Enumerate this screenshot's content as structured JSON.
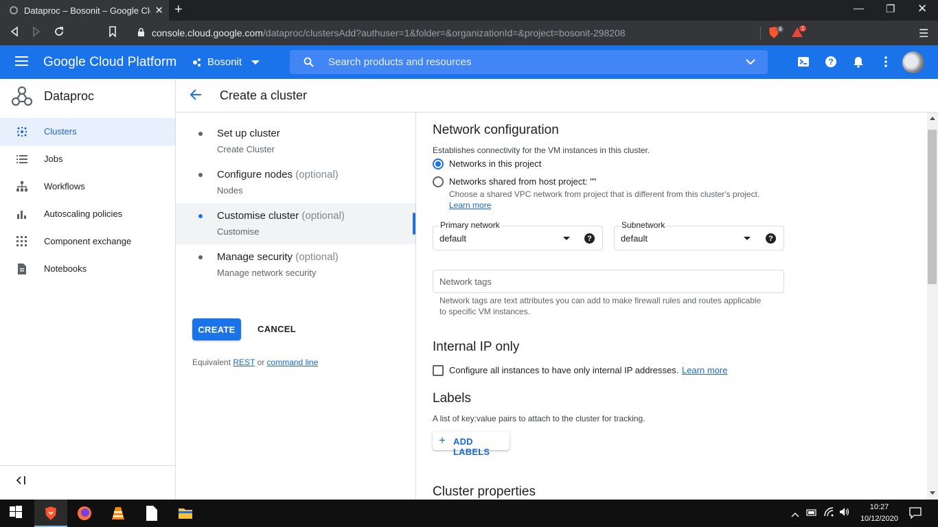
{
  "browser": {
    "tab_title": "Dataproc – Bosonit – Google Cloud",
    "url_host": "console.cloud.google.com",
    "url_path": "/dataproc/clustersAdd?authuser=1&folder=&organizationId=&project=bosonit-298208",
    "brave_badge": "4",
    "alert_badge": "1"
  },
  "header": {
    "brand": "Google Cloud Platform",
    "project": "Bosonit",
    "search_placeholder": "Search products and resources"
  },
  "sidebar": {
    "product": "Dataproc",
    "items": [
      {
        "label": "Clusters",
        "icon": "clusters-icon",
        "active": true
      },
      {
        "label": "Jobs",
        "icon": "list-icon",
        "active": false
      },
      {
        "label": "Workflows",
        "icon": "workflow-icon",
        "active": false
      },
      {
        "label": "Autoscaling policies",
        "icon": "bar-chart-icon",
        "active": false
      },
      {
        "label": "Component exchange",
        "icon": "grid-icon",
        "active": false
      },
      {
        "label": "Notebooks",
        "icon": "document-icon",
        "active": false
      }
    ]
  },
  "page": {
    "title": "Create a cluster"
  },
  "steps": [
    {
      "title": "Set up cluster",
      "optional": "",
      "subtitle": "Create Cluster",
      "active": false
    },
    {
      "title": "Configure nodes",
      "optional": "(optional)",
      "subtitle": "Nodes",
      "active": false
    },
    {
      "title": "Customise cluster",
      "optional": "(optional)",
      "subtitle": "Customise",
      "active": true
    },
    {
      "title": "Manage security",
      "optional": "(optional)",
      "subtitle": "Manage network security",
      "active": false
    }
  ],
  "actions": {
    "create": "CREATE",
    "cancel": "CANCEL",
    "equiv_prefix": "Equivalent",
    "rest": "REST",
    "or": "or",
    "command_line": "command line"
  },
  "network": {
    "heading": "Network configuration",
    "description": "Establishes connectivity for the VM instances in this cluster.",
    "option_project": "Networks in this project",
    "option_shared": "Networks shared from host project: \"\"",
    "shared_help": "Choose a shared VPC network from project that is different from this cluster's project.",
    "learn_more": "Learn more",
    "primary_network_label": "Primary network",
    "primary_network_value": "default",
    "subnetwork_label": "Subnetwork",
    "subnetwork_value": "default",
    "tags_placeholder": "Network tags",
    "tags_help_1": "Network tags are text attributes you can add to make firewall rules and routes applicable",
    "tags_help_2": "to specific VM instances."
  },
  "internal_ip": {
    "heading": "Internal IP only",
    "checkbox_label": "Configure all instances to have only internal IP addresses.",
    "learn_more": "Learn more"
  },
  "labels": {
    "heading": "Labels",
    "description": "A list of key:value pairs to attach to the cluster for tracking.",
    "add_button": "ADD LABELS"
  },
  "cluster_properties": {
    "heading": "Cluster properties"
  },
  "taskbar": {
    "time": "10:27",
    "date": "10/12/2020"
  },
  "colors": {
    "gcp_blue": "#1a73e8",
    "active_nav_bg": "#e8f0fe"
  }
}
